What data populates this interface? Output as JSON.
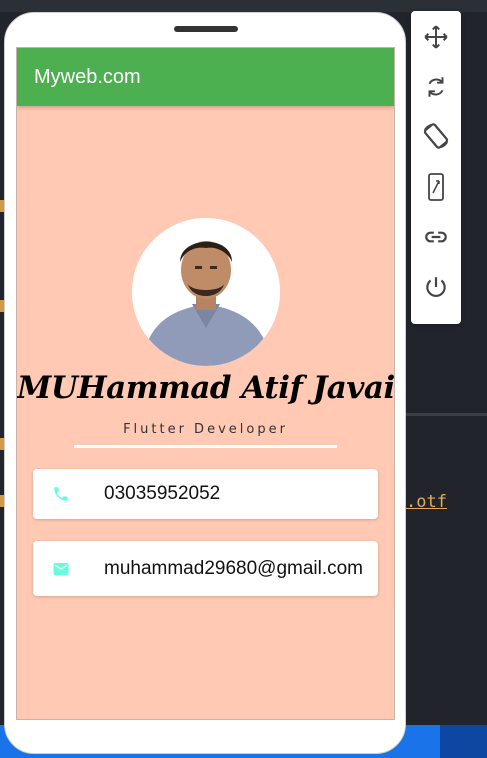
{
  "app": {
    "title": "Myweb.com"
  },
  "profile": {
    "name": "MUHammad Atif Javaid",
    "role": "Flutter Developer"
  },
  "contacts": {
    "phone": "03035952052",
    "email": "muhammad29680@gmail.com"
  },
  "toolbar": {
    "items": [
      "move-icon",
      "rotate-icon",
      "rotate-screen-icon",
      "resize-icon",
      "link-icon",
      "power-icon"
    ]
  },
  "background": {
    "snippet": ".otf"
  },
  "colors": {
    "appbar": "#4caf50",
    "screen_bg": "#ffc9b3",
    "contact_icon": "#64ffda"
  }
}
